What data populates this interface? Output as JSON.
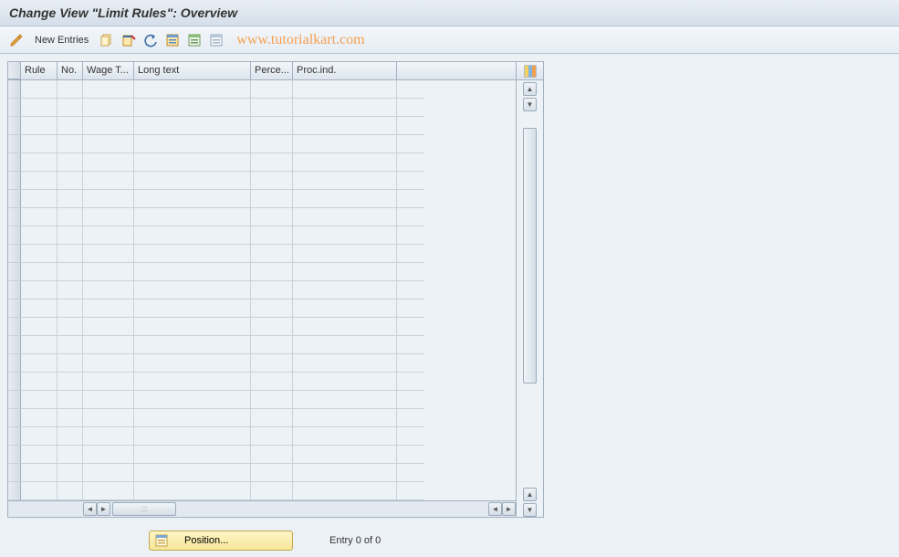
{
  "title": "Change View \"Limit Rules\": Overview",
  "toolbar": {
    "new_entries_label": "New Entries",
    "watermark": "www.tutorialkart.com"
  },
  "columns": {
    "rule": "Rule",
    "no": "No.",
    "wage": "Wage T...",
    "long": "Long text",
    "perce": "Perce...",
    "proc": "Proc.ind."
  },
  "row_count": 23,
  "footer": {
    "position_label": "Position...",
    "entry_text": "Entry 0 of 0"
  }
}
